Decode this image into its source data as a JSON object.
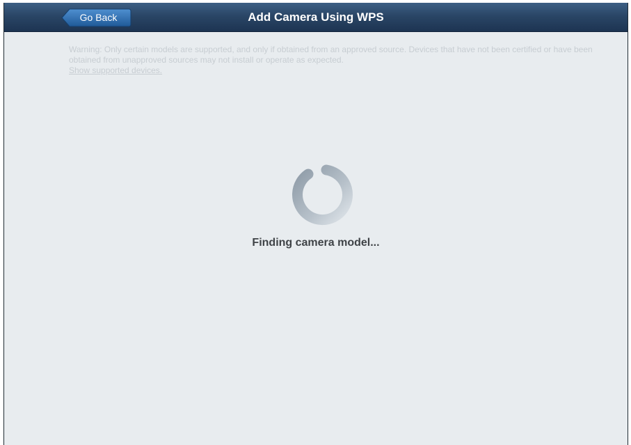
{
  "header": {
    "back_label": "Go Back",
    "title": "Add Camera Using WPS"
  },
  "warning": {
    "text": "Warning: Only certain models are supported, and only if obtained from an approved source. Devices that have not been certified or have been obtained from unapproved sources may not install or operate as expected.",
    "link_label": "Show supported devices."
  },
  "status": {
    "text": "Finding camera model..."
  },
  "colors": {
    "header_top": "#3d5f84",
    "header_bottom": "#1d3452",
    "back_button": "#2f6fb0",
    "background": "#e8ecef",
    "warning_text": "#c7cdd2",
    "status_text": "#3f4347"
  },
  "icons": {
    "spinner": "loading-spinner-icon"
  }
}
